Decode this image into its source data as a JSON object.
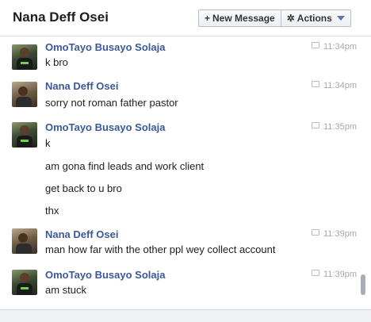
{
  "header": {
    "title": "Nana Deff Osei",
    "new_message_label": "New Message",
    "new_message_glyph": "+",
    "actions_label": "Actions",
    "actions_glyph": "✲"
  },
  "messages": [
    {
      "sender": "OmoTayo Busayo Solaja",
      "time": "11:34pm",
      "avatar": "omotayo-avatar",
      "lines": [
        "k bro"
      ]
    },
    {
      "sender": "Nana Deff Osei",
      "time": "11:34pm",
      "avatar": "nana-avatar",
      "lines": [
        "sorry not roman father pastor"
      ]
    },
    {
      "sender": "OmoTayo Busayo Solaja",
      "time": "11:35pm",
      "avatar": "omotayo-avatar",
      "lines": [
        "k",
        "am gona find leads and work client",
        "get back to u bro",
        "thx"
      ]
    },
    {
      "sender": "Nana Deff Osei",
      "time": "11:39pm",
      "avatar": "nana-avatar",
      "lines": [
        "man how far with the other ppl wey collect account"
      ]
    },
    {
      "sender": "OmoTayo Busayo Solaja",
      "time": "11:39pm",
      "avatar": "omotayo-avatar",
      "lines": [
        "am stuck"
      ]
    }
  ],
  "colors": {
    "sender": "#3b5998",
    "timestamp": "#a3a8b3",
    "text": "#1c1e21"
  }
}
